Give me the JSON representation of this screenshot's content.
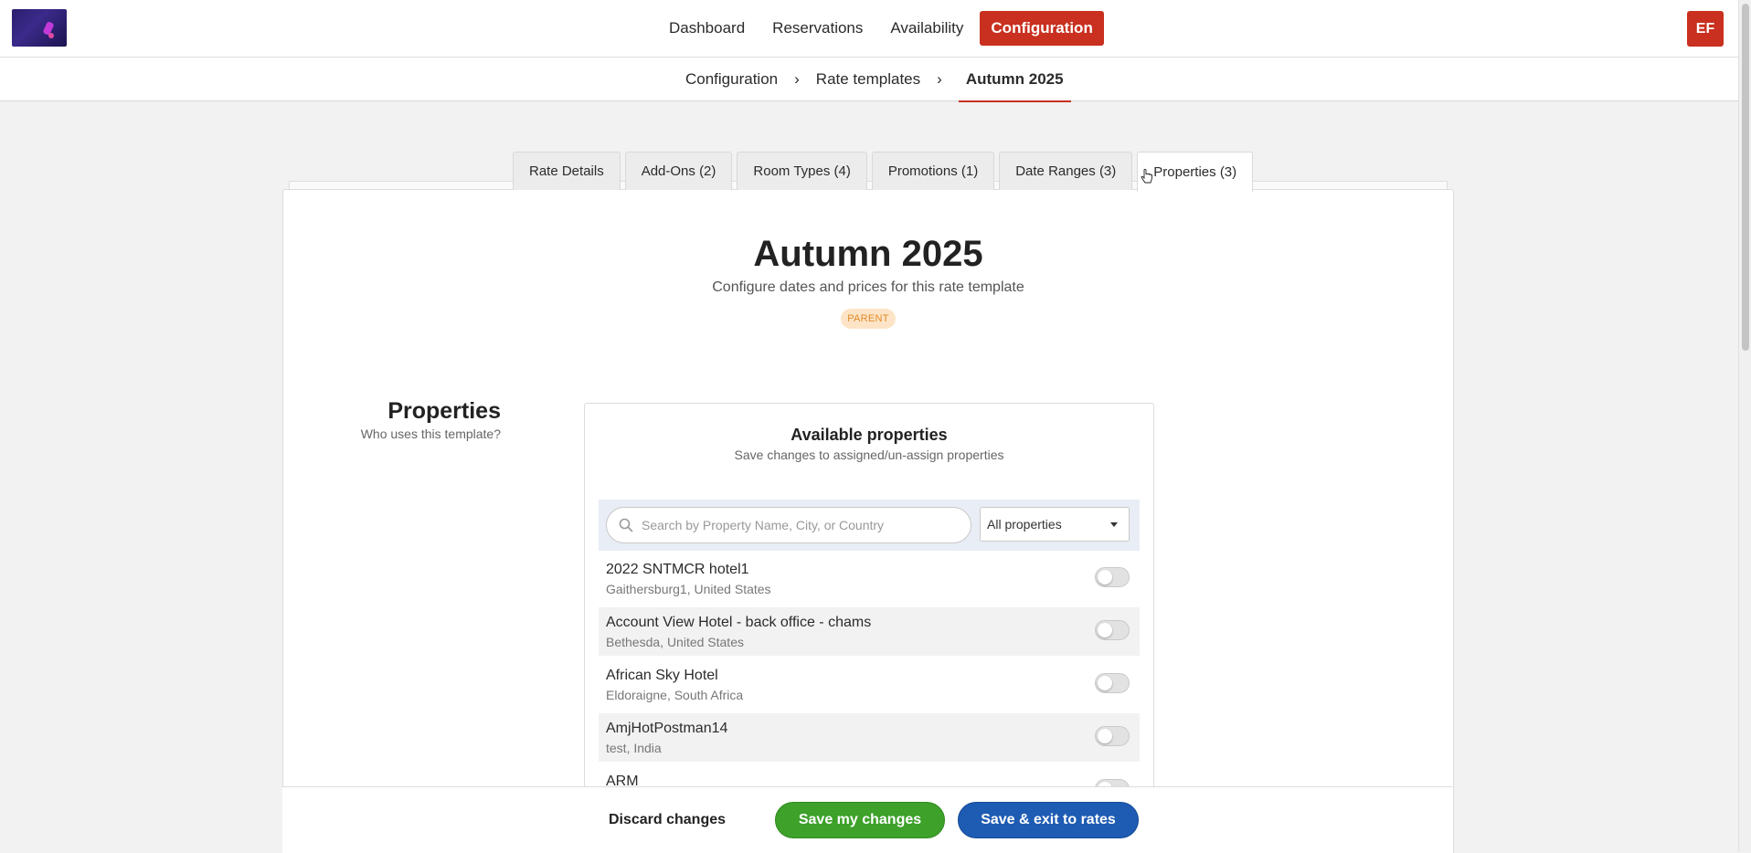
{
  "nav": {
    "items": [
      {
        "label": "Dashboard",
        "active": false
      },
      {
        "label": "Reservations",
        "active": false
      },
      {
        "label": "Availability",
        "active": false
      },
      {
        "label": "Configuration",
        "active": true
      }
    ],
    "avatar_initials": "EF"
  },
  "breadcrumb": {
    "items": [
      "Configuration",
      "Rate templates",
      "Autumn 2025"
    ],
    "separator": "›"
  },
  "tabs": [
    {
      "label": "Rate Details",
      "active": false
    },
    {
      "label": "Add-Ons (2)",
      "active": false
    },
    {
      "label": "Room Types (4)",
      "active": false
    },
    {
      "label": "Promotions (1)",
      "active": false
    },
    {
      "label": "Date Ranges (3)",
      "active": false
    },
    {
      "label": "Properties (3)",
      "active": true
    }
  ],
  "header": {
    "title": "Autumn 2025",
    "subtitle": "Configure dates and prices for this rate template",
    "badge": "PARENT"
  },
  "section": {
    "title": "Properties",
    "subtitle": "Who uses this template?"
  },
  "panel": {
    "title": "Available properties",
    "subtitle": "Save changes to assigned/un-assign properties",
    "search_placeholder": "Search by Property Name, City, or Country",
    "filter_selected": "All properties"
  },
  "properties": [
    {
      "name": "2022 SNTMCR hotel1",
      "location": "Gaithersburg1, United States",
      "assigned": false
    },
    {
      "name": "Account View Hotel - back office - chams",
      "location": "Bethesda, United States",
      "assigned": false
    },
    {
      "name": "African Sky Hotel",
      "location": "Eldoraigne, South Africa",
      "assigned": false
    },
    {
      "name": "AmjHotPostman14",
      "location": "test, India",
      "assigned": false
    },
    {
      "name": "ARM",
      "location": "",
      "assigned": false
    }
  ],
  "footer": {
    "discard_label": "Discard changes",
    "save_label": "Save my changes",
    "save_exit_label": "Save & exit to rates"
  },
  "colors": {
    "brand_red": "#c9301f",
    "save_green": "#3da12a",
    "exit_blue": "#1e5cb3",
    "badge_bg": "#fde4c6",
    "badge_text": "#e08a2b"
  }
}
